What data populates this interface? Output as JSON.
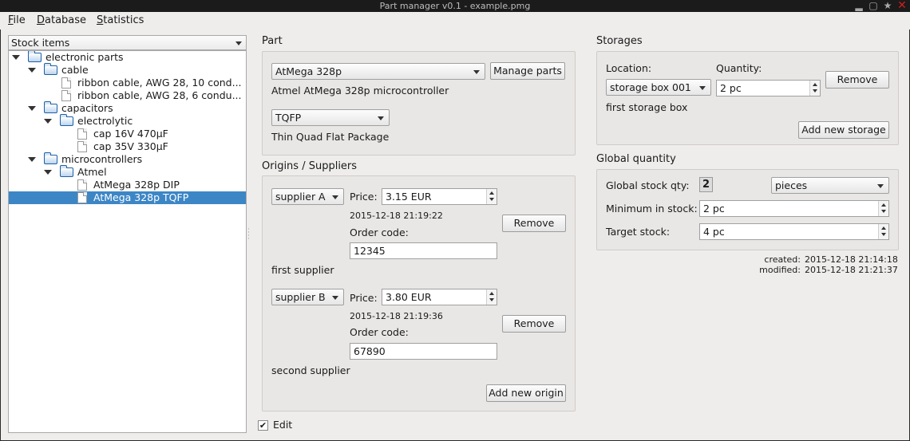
{
  "window": {
    "title": "Part manager v0.1 - example.pmg"
  },
  "menu": {
    "file": "File",
    "database": "Database",
    "statistics": "Statistics"
  },
  "stock": {
    "header": "Stock items",
    "tree": [
      {
        "label": "electronic parts",
        "type": "folder",
        "level": 0,
        "expanded": true
      },
      {
        "label": "cable",
        "type": "folder",
        "level": 1,
        "expanded": true
      },
      {
        "label": "ribbon cable, AWG 28, 10 cond...",
        "type": "item",
        "level": 2
      },
      {
        "label": "ribbon cable, AWG 28, 6 condu...",
        "type": "item",
        "level": 2
      },
      {
        "label": "capacitors",
        "type": "folder",
        "level": 1,
        "expanded": true
      },
      {
        "label": "electrolytic",
        "type": "folder",
        "level": 2,
        "expanded": true
      },
      {
        "label": "cap 16V 470µF",
        "type": "item",
        "level": 3
      },
      {
        "label": "cap 35V 330µF",
        "type": "item",
        "level": 3
      },
      {
        "label": "microcontrollers",
        "type": "folder",
        "level": 1,
        "expanded": true
      },
      {
        "label": "Atmel",
        "type": "folder",
        "level": 2,
        "expanded": true
      },
      {
        "label": "AtMega 328p DIP",
        "type": "item",
        "level": 3
      },
      {
        "label": "AtMega 328p TQFP",
        "type": "item",
        "level": 3,
        "selected": true
      }
    ]
  },
  "part": {
    "title": "Part",
    "selected_part": "AtMega 328p",
    "manage_label": "Manage parts",
    "description": "Atmel AtMega 328p microcontroller",
    "package": "TQFP",
    "package_description": "Thin Quad Flat Package"
  },
  "origins": {
    "title": "Origins / Suppliers",
    "price_label": "Price:",
    "order_code_label": "Order code:",
    "remove_label": "Remove",
    "add_label": "Add new origin",
    "suppliers": [
      {
        "name": "supplier A",
        "price": "3.15 EUR",
        "date": "2015-12-18 21:19:22",
        "order_code": "12345",
        "note": "first supplier"
      },
      {
        "name": "supplier B",
        "price": "3.80 EUR",
        "date": "2015-12-18 21:19:36",
        "order_code": "67890",
        "note": "second supplier"
      }
    ]
  },
  "storages": {
    "title": "Storages",
    "location_label": "Location:",
    "quantity_label": "Quantity:",
    "location": "storage box 001",
    "quantity": "2 pc",
    "remove_label": "Remove",
    "description": "first storage box",
    "add_label": "Add new storage"
  },
  "global": {
    "title": "Global quantity",
    "stock_qty_label": "Global stock qty:",
    "stock_qty": "2",
    "unit": "pieces",
    "min_label": "Minimum in stock:",
    "min_value": "2 pc",
    "target_label": "Target stock:",
    "target_value": "4 pc"
  },
  "meta": {
    "created_label": "created:",
    "created": "2015-12-18 21:14:18",
    "modified_label": "modified:",
    "modified": "2015-12-18 21:21:37"
  },
  "edit": {
    "label": "Edit",
    "checked": true,
    "check_glyph": "✔"
  }
}
